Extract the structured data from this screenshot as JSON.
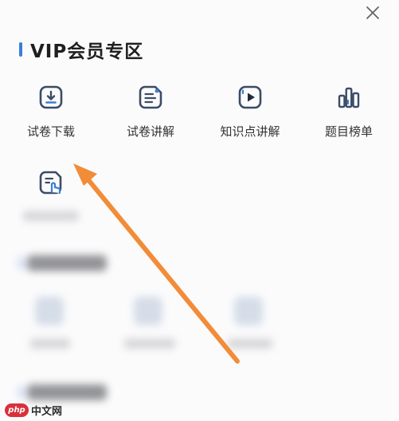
{
  "section": {
    "title": "VIP会员专区",
    "accent_color": "#3a80d6"
  },
  "close_icon": "close-icon",
  "vip_items": [
    {
      "label": "试卷下载",
      "icon": "download-icon"
    },
    {
      "label": "试卷讲解",
      "icon": "document-lines-icon"
    },
    {
      "label": "知识点讲解",
      "icon": "video-play-icon"
    },
    {
      "label": "题目榜单",
      "icon": "bar-chart-icon"
    },
    {
      "icon": "document-hand-icon"
    }
  ],
  "arrow_color": "#f28c38",
  "watermark": {
    "logo": "php",
    "site": "中文网",
    "logo_color": "#d9303a"
  }
}
